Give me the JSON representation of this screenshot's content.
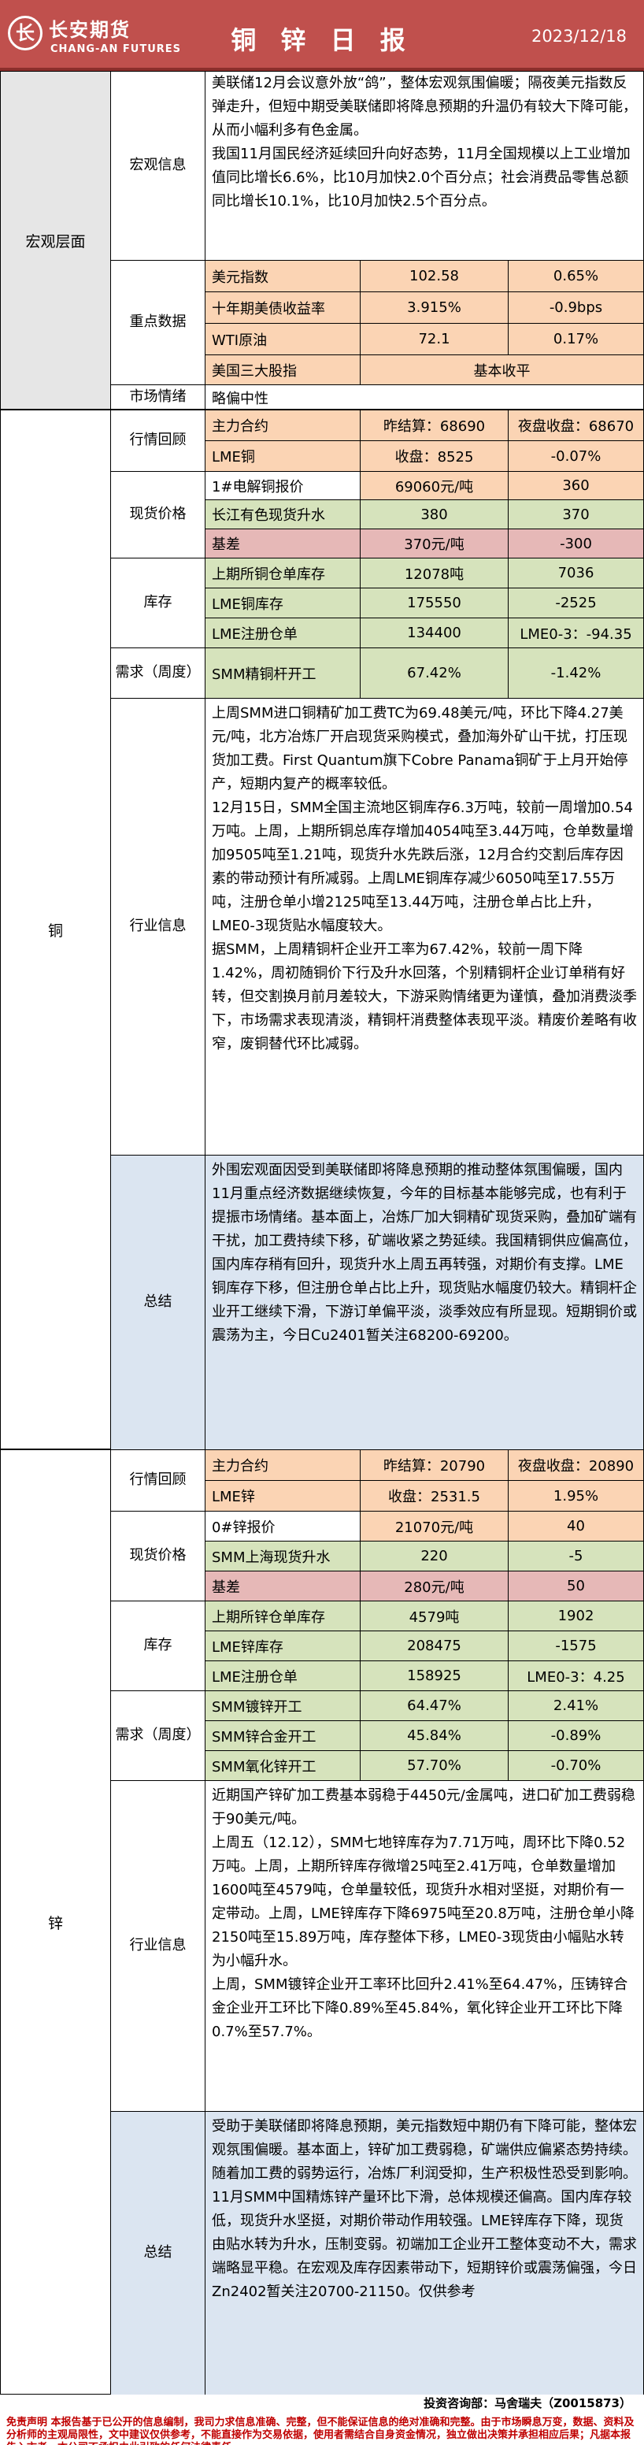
{
  "header": {
    "logo_glyph": "长",
    "company_cn": "长安期货",
    "company_en": "CHANG-AN FUTURES",
    "title": "铜 锌 日 报",
    "date": "2023/12/18",
    "bg_color": "#c0504d"
  },
  "macro": {
    "section_label": "宏观层面",
    "info_label": "宏观信息",
    "info_text": "美联储12月会议意外放“鸽”，整体宏观氛围偏暖；隔夜美元指数反弹走升，但短中期受美联储即将降息预期的升温仍有较大下降可能，从而小幅利多有色金属。\n我国11月国民经济延续回升向好态势，11月全国规模以上工业增加值同比增长6.6%，比10月加快2.0个百分点；社会消费品零售总额同比增长10.1%，比10月加快2.5个百分点。",
    "key_data_label": "重点数据",
    "key_data": [
      {
        "name": "美元指数",
        "value": "102.58",
        "change": "0.65%"
      },
      {
        "name": "十年期美债收益率",
        "value": "3.915%",
        "change": "-0.9bps"
      },
      {
        "name": "WTI原油",
        "value": "72.1",
        "change": "0.17%"
      },
      {
        "name": "美国三大股指",
        "value": "基本收平"
      }
    ],
    "sentiment_label": "市场情绪",
    "sentiment_value": "略偏中性"
  },
  "copper": {
    "section_label": "铜",
    "review_label": "行情回顾",
    "review": [
      {
        "c1": "主力合约",
        "c2": "昨结算：68690",
        "c3": "夜盘收盘：68670"
      },
      {
        "c1": "LME铜",
        "c2": "收盘：8525",
        "c3": "-0.07%"
      }
    ],
    "spot_label": "现货价格",
    "spot": [
      {
        "c1": "1#电解铜报价",
        "c2": "69060元/吨",
        "c3": "360"
      },
      {
        "c1": "长江有色现货升水",
        "c2": "380",
        "c3": "370"
      },
      {
        "c1": "基差",
        "c2": "370元/吨",
        "c3": "-300"
      }
    ],
    "inventory_label": "库存",
    "inventory": [
      {
        "c1": "上期所铜仓单库存",
        "c2": "12078吨",
        "c3": "7036"
      },
      {
        "c1": "LME铜库存",
        "c2": "175550",
        "c3": "-2525"
      },
      {
        "c1": "LME注册仓单",
        "c2": "134400",
        "c3": "LME0-3：-94.35"
      }
    ],
    "demand_label": "需求（周度）",
    "demand": [
      {
        "c1": "SMM精铜杆开工",
        "c2": "67.42%",
        "c3": "-1.42%"
      }
    ],
    "industry_label": "行业信息",
    "industry_text": "上周SMM进口铜精矿加工费TC为69.48美元/吨，环比下降4.27美元/吨，北方冶炼厂开启现货采购模式，叠加海外矿山干扰，打压现货加工费。First Quantum旗下Cobre Panama铜矿于上月开始停产，短期内复产的概率较低。\n12月15日，SMM全国主流地区铜库存6.3万吨，较前一周增加0.54万吨。上周，上期所铜总库存增加4054吨至3.44万吨，仓单数量增加9505吨至1.21吨，现货升水先跌后涨，12月合约交割后库存因素的带动预计有所减弱。上周LME铜库存减少6050吨至17.55万吨，注册仓单小增2125吨至13.44万吨，注册仓单占比上升，LME0-3现货贴水幅度较大。\n据SMM，上周精铜杆企业开工率为67.42%，较前一周下降1.42%，周初随铜价下行及升水回落，个别精铜杆企业订单稍有好转，但交割换月前月差较大，下游采购情绪更为谨慎，叠加消费淡季下，市场需求表现清淡，精铜杆消费整体表现平淡。精废价差略有收窄，废铜替代环比减弱。",
    "summary_label": "总结",
    "summary_text": "外围宏观面因受到美联储即将降息预期的推动整体氛围偏暖，国内11月重点经济数据继续恢复，今年的目标基本能够完成，也有利于提振市场情绪。基本面上，冶炼厂加大铜精矿现货采购，叠加矿端有干扰，加工费持续下移，矿端收紧之势延续。我国精铜供应偏高位，国内库存稍有回升，现货升水上周五再转强，对期价有支撑。LME铜库存下移，但注册仓单占比上升，现货贴水幅度仍较大。精铜杆企业开工继续下滑，下游订单偏平淡，淡季效应有所显现。短期铜价或震荡为主，今日Cu2401暂关注68200-69200。"
  },
  "zinc": {
    "section_label": "锌",
    "review_label": "行情回顾",
    "review": [
      {
        "c1": "主力合约",
        "c2": "昨结算：20790",
        "c3": "夜盘收盘：20890"
      },
      {
        "c1": "LME锌",
        "c2": "收盘：2531.5",
        "c3": "1.95%"
      }
    ],
    "spot_label": "现货价格",
    "spot": [
      {
        "c1": "0#锌报价",
        "c2": "21070元/吨",
        "c3": "40"
      },
      {
        "c1": "SMM上海现货升水",
        "c2": "220",
        "c3": "-5"
      },
      {
        "c1": "基差",
        "c2": "280元/吨",
        "c3": "50"
      }
    ],
    "inventory_label": "库存",
    "inventory": [
      {
        "c1": "上期所锌仓单库存",
        "c2": "4579吨",
        "c3": "1902"
      },
      {
        "c1": "LME锌库存",
        "c2": "208475",
        "c3": "-1575"
      },
      {
        "c1": "LME注册仓单",
        "c2": "158925",
        "c3": "LME0-3：4.25"
      }
    ],
    "demand_label": "需求（周度）",
    "demand": [
      {
        "c1": "SMM镀锌开工",
        "c2": "64.47%",
        "c3": "2.41%"
      },
      {
        "c1": "SMM锌合金开工",
        "c2": "45.84%",
        "c3": "-0.89%"
      },
      {
        "c1": "SMM氧化锌开工",
        "c2": "57.70%",
        "c3": "-0.70%"
      }
    ],
    "industry_label": "行业信息",
    "industry_text": "近期国产锌矿加工费基本弱稳于4450元/金属吨，进口矿加工费弱稳于90美元/吨。\n上周五（12.12），SMM七地锌库存为7.71万吨，周环比下降0.52万吨。上周，上期所锌库存微增25吨至2.41万吨，仓单数量增加1600吨至4579吨，仓单量较低，现货升水相对坚挺，对期价有一定带动。上周，LME锌库存下降6975吨至20.8万吨，注册仓单小降2150吨至15.89万吨，库存整体下移，LME0-3现货由小幅贴水转为小幅升水。\n上周，SMM镀锌企业开工率环比回升2.41%至64.47%，压铸锌合金企业开工环比下降0.89%至45.84%，氧化锌企业开工环比下降0.7%至57.7%。",
    "summary_label": "总结",
    "summary_text": "受助于美联储即将降息预期，美元指数短中期仍有下降可能，整体宏观氛围偏暖。基本面上，锌矿加工费弱稳，矿端供应偏紧态势持续。随着加工费的弱势运行，冶炼厂利润受抑，生产积极性恐受到影响。11月SMM中国精炼锌产量环比下滑，总体规模还偏高。国内库存较低，现货升水坚挺，对期价带动作用较强。LME锌库存下降，现货由贴水转为升水，压制变弱。初端加工企业开工整体变动不大，需求端略显平稳。在宏观及库存因素带动下，短期锌价或震荡偏强，今日Zn2402暂关注20700-21150。仅供参考"
  },
  "footer": {
    "contact": "投资咨询部：马舍瑞夫（Z0015873）",
    "disclaimer": "免责声明\n本报告基于已公开的信息编制，我司力求信息准确、完整，但不能保证信息的绝对准确和完整。由于市场瞬息万变，数据、资料及分析师的主观局限性，文中建议仅供参考，不能直接作为交易依据，使用者需结合自身资金情况，独立做出决策并承担相应后果；凡据本报告入市者，本公司不承担由此引致的任何法律责任。"
  }
}
